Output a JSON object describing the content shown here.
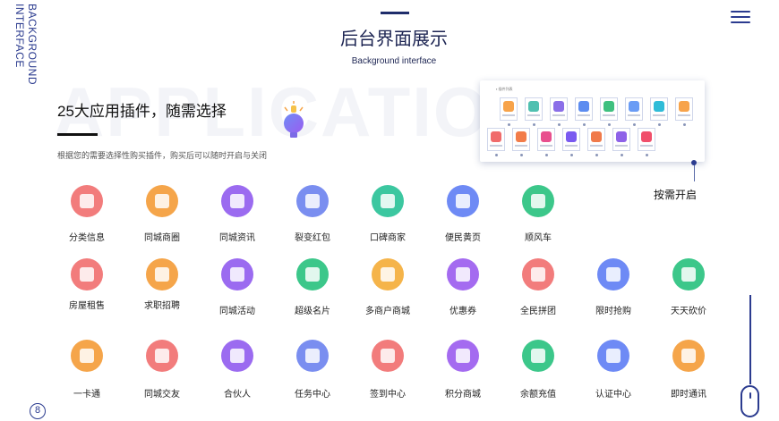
{
  "side_label": {
    "line1": "BACKGROUND",
    "line2": "INTERFACE"
  },
  "header": {
    "title": "后台界面展示",
    "subtitle": "Background interface"
  },
  "watermark": "APPLICATION",
  "plugins": {
    "title": "25大应用插件，随需选择",
    "description": "根据您的需要选择性购买插件，购买后可以随时开启与关闭"
  },
  "on_demand_label": "按需开启",
  "page_number": "8",
  "preview_colors": [
    "#f7a34a",
    "#4fc0b0",
    "#8a6ee8",
    "#5c8cf0",
    "#3fc07f",
    "#6a9cf5",
    "#2fbcd8",
    "#f7a34a",
    "#f06b6b",
    "#f27c4a",
    "#e84f8e",
    "#7a5af0",
    "#f07a4a",
    "#8e62e8",
    "#f04f6b"
  ],
  "apps": [
    {
      "label": "分类信息",
      "color": "#f27c7c"
    },
    {
      "label": "同城商圈",
      "color": "#f5a54a"
    },
    {
      "label": "同城资讯",
      "color": "#9b6bf0"
    },
    {
      "label": "裂变红包",
      "color": "#7a8ef0"
    },
    {
      "label": "口碑商家",
      "color": "#3cc7a0"
    },
    {
      "label": "便民黄页",
      "color": "#6e8af5"
    },
    {
      "label": "顺风车",
      "color": "#3cc78a"
    },
    {
      "label": "房屋租售",
      "color": "#f27c7c"
    },
    {
      "label": "求职招聘",
      "color": "#f5a54a"
    },
    {
      "label": "同城活动",
      "color": "#9b6bf0"
    },
    {
      "label": "超级名片",
      "color": "#3cc78a"
    },
    {
      "label": "多商户商城",
      "color": "#f5b44a"
    },
    {
      "label": "优惠券",
      "color": "#a46bf0"
    },
    {
      "label": "全民拼团",
      "color": "#f27c7c"
    },
    {
      "label": "限时抢购",
      "color": "#6e8af5"
    },
    {
      "label": "天天砍价",
      "color": "#3cc78a"
    },
    {
      "label": "一卡通",
      "color": "#f5a54a"
    },
    {
      "label": "同城交友",
      "color": "#f27c7c"
    },
    {
      "label": "合伙人",
      "color": "#9b6bf0"
    },
    {
      "label": "任务中心",
      "color": "#7a8ef0"
    },
    {
      "label": "签到中心",
      "color": "#f27c7c"
    },
    {
      "label": "积分商城",
      "color": "#a46bf0"
    },
    {
      "label": "余额充值",
      "color": "#3cc78a"
    },
    {
      "label": "认证中心",
      "color": "#6e8af5"
    },
    {
      "label": "即时通讯",
      "color": "#f5a54a"
    }
  ]
}
